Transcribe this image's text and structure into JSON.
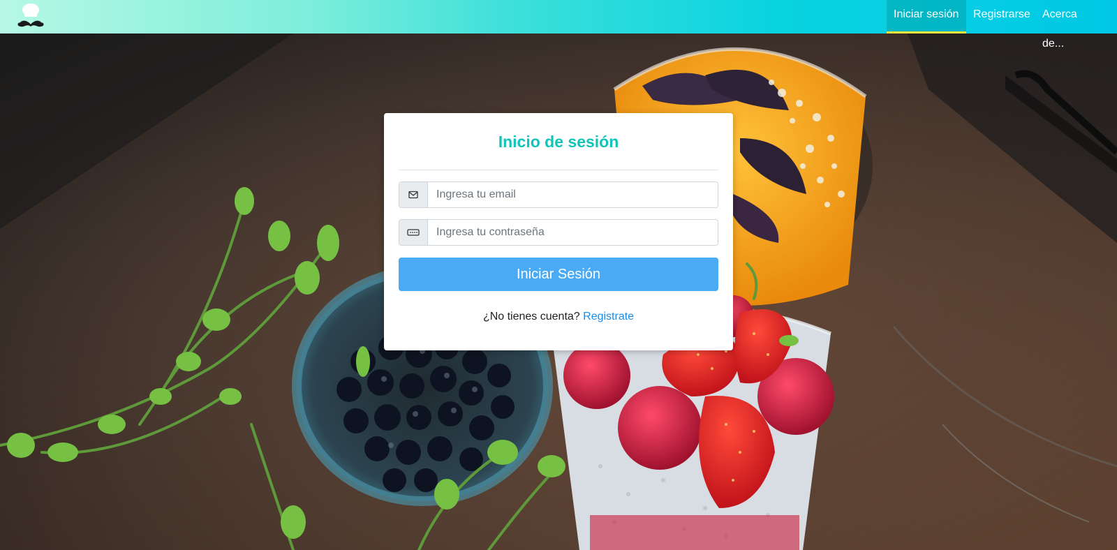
{
  "navbar": {
    "logo_icon": "chef-mustache-logo",
    "links": [
      {
        "label": "Iniciar sesión",
        "active": true
      },
      {
        "label": "Registrarse",
        "active": false
      },
      {
        "label": "Acerca de...",
        "active": false
      }
    ],
    "accent_color": "#f3e53a"
  },
  "login": {
    "title": "Inicio de sesión",
    "email": {
      "placeholder": "Ingresa tu email",
      "value": "",
      "icon": "envelope-icon"
    },
    "password": {
      "placeholder": "Ingresa tu contraseña",
      "value": "",
      "icon": "password-dots-icon"
    },
    "submit_label": "Iniciar Sesión",
    "no_account_text": "¿No tienes cuenta?",
    "register_link": "Registrate"
  },
  "colors": {
    "title": "#10c4b8",
    "button": "#4aaaf3",
    "link": "#1a8ce8"
  }
}
